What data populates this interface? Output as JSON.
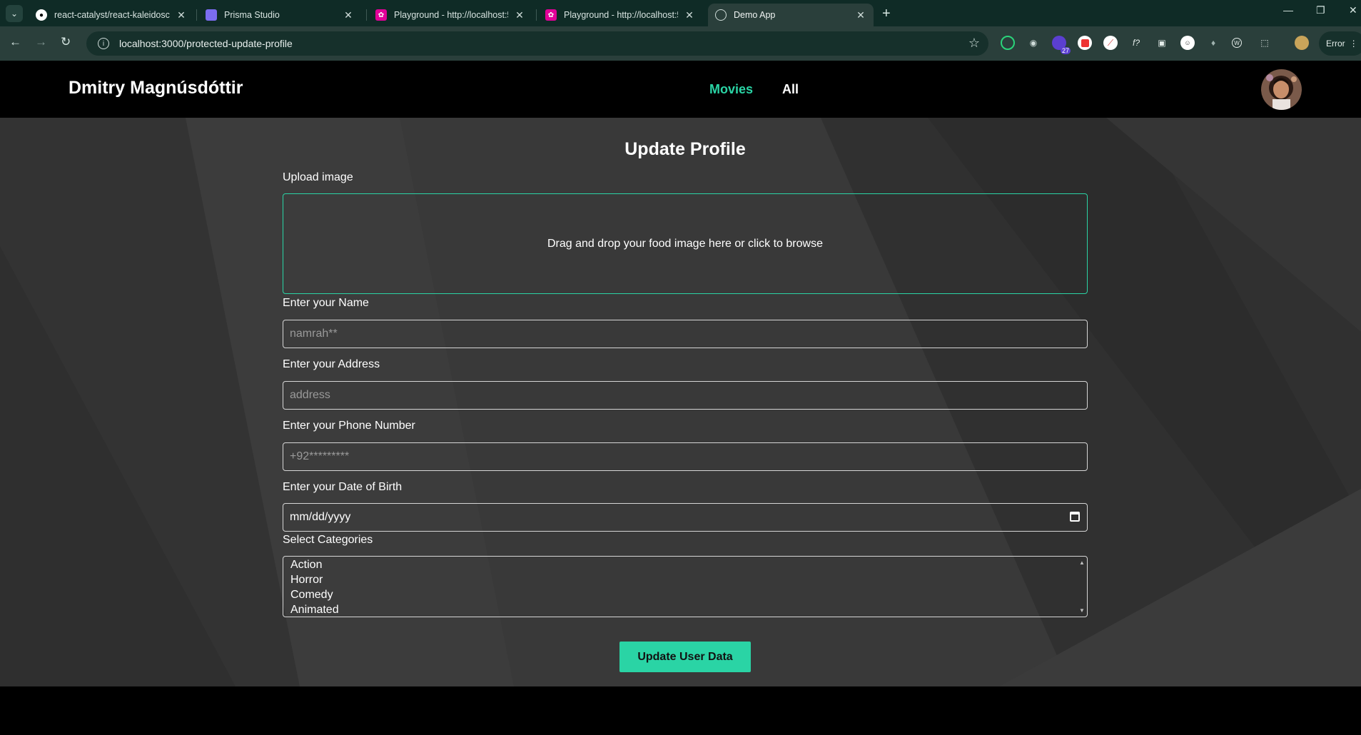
{
  "browser": {
    "tabs": [
      {
        "title": "react-catalyst/react-kaleidoscop",
        "icon": "github-icon"
      },
      {
        "title": "Prisma Studio",
        "icon": "prisma-icon"
      },
      {
        "title": "Playground - http://localhost:5(",
        "icon": "graphql-icon"
      },
      {
        "title": "Playground - http://localhost:5(",
        "icon": "graphql-icon"
      },
      {
        "title": "Demo App",
        "icon": "globe-icon",
        "active": true
      }
    ],
    "url": "localhost:3000/protected-update-profile",
    "extension_badge": "27",
    "error_label": "Error"
  },
  "header": {
    "brand": "Dmitry Magnúsdóttir",
    "nav": [
      {
        "label": "Movies",
        "color": "#2ad4a5"
      },
      {
        "label": "All",
        "color": "#ffffff"
      }
    ]
  },
  "form": {
    "title": "Update Profile",
    "upload_label": "Upload image",
    "dropzone_text": "Drag and drop your food image here or click to browse",
    "name_label": "Enter your Name",
    "name_placeholder": "namrah**",
    "address_label": "Enter your Address",
    "address_placeholder": "address",
    "phone_label": "Enter your Phone Number",
    "phone_placeholder": "+92*********",
    "dob_label": "Enter your Date of Birth",
    "dob_value": "mm/dd/yyyy",
    "categories_label": "Select Categories",
    "categories": [
      "Action",
      "Horror",
      "Comedy",
      "Animated"
    ],
    "submit_label": "Update User Data"
  },
  "colors": {
    "accent": "#2ad4a5",
    "background": "#393939"
  }
}
